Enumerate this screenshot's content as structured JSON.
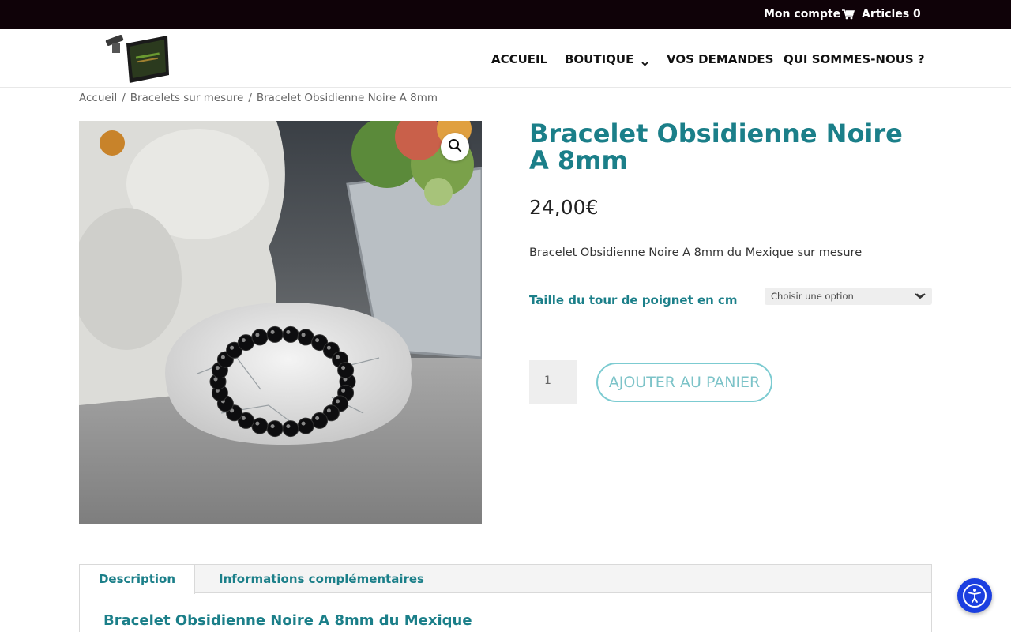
{
  "topbar": {
    "account_label": "Mon compte",
    "cart_label": "Articles 0",
    "cart_icon": "cart-icon"
  },
  "header": {
    "logo_icon": "logo-icon",
    "nav": {
      "accueil": "ACCUEIL",
      "boutique": "BOUTIQUE",
      "demandes": "VOS DEMANDES",
      "qui": "QUI SOMMES-NOUS ?"
    }
  },
  "breadcrumb": {
    "items": [
      "Accueil",
      "Bracelets sur mesure",
      "Bracelet Obsidienne Noire A 8mm"
    ],
    "separator": "/"
  },
  "product": {
    "title": "Bracelet Obsidienne Noire A 8mm",
    "price": "24,00€",
    "short_description": "Bracelet Obsidienne Noire A 8mm du Mexique sur mesure",
    "variation_label": "Taille du tour de poignet en cm",
    "variation_select_value": "Choisir une option",
    "quantity": "1",
    "add_to_cart_label": "AJOUTER AU PANIER",
    "zoom_icon": "magnifier-icon"
  },
  "tabs": {
    "items": [
      "Description",
      "Informations complémentaires"
    ],
    "active": "Description",
    "panel_heading": "Bracelet Obsidienne Noire A 8mm du Mexique"
  },
  "colors": {
    "accent": "#1b7f89",
    "topbar_bg": "#0f0208",
    "button_border": "#7ccbd1",
    "accessibility": "#1b3fe0"
  }
}
